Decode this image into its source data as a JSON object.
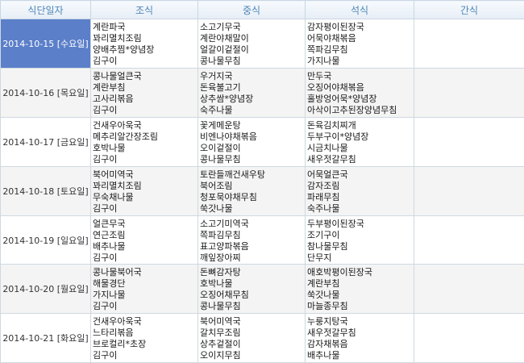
{
  "headers": {
    "date": "식단일자",
    "breakfast": "조식",
    "lunch": "중식",
    "dinner": "석식",
    "snack": "간식"
  },
  "rows": [
    {
      "date": "2014-10-15 [수요일]",
      "selected": true,
      "breakfast": [
        "계란파국",
        "꽈리멸치조림",
        "양배추찜*양념장",
        "김구이"
      ],
      "lunch": [
        "소고기무국",
        "계란야채말이",
        "얼갈이겉절이",
        "콩나물무침"
      ],
      "dinner": [
        "감자평이된장국",
        "어묵야채볶음",
        "쪽파김무침",
        "가지나물"
      ],
      "snack": []
    },
    {
      "date": "2014-10-16 [목요일]",
      "selected": false,
      "breakfast": [
        "콩나물얼큰국",
        "계란부침",
        "고사리볶음",
        "김구이"
      ],
      "lunch": [
        "우거지국",
        "돈육불고기",
        "상추쌈*양념장",
        "숙주나물"
      ],
      "dinner": [
        "만두국",
        "오징어야채볶음",
        "홀방엉어묵*양념장",
        "아삭이고추된장양념무침"
      ],
      "snack": []
    },
    {
      "date": "2014-10-17 [금요일]",
      "selected": false,
      "breakfast": [
        "건새우아욱국",
        "메추리알간장조림",
        "호박나물",
        "김구이"
      ],
      "lunch": [
        "꽃게메운탕",
        "비엔나야채볶음",
        "오이겉절이",
        "콩나물무침"
      ],
      "dinner": [
        "돈육김치찌개",
        "두부구이*양념장",
        "시금치나물",
        "새우젓갈무침"
      ],
      "snack": []
    },
    {
      "date": "2014-10-18 [토요일]",
      "selected": false,
      "breakfast": [
        "북어미역국",
        "꽈리멸치조림",
        "무숙채나물",
        "김구이"
      ],
      "lunch": [
        "토란들깨건새우탕",
        "북어조림",
        "청포묵야채무침",
        "쑥갓나물"
      ],
      "dinner": [
        "어묵얼큰국",
        "감자조림",
        "파래무침",
        "숙주나물"
      ],
      "snack": []
    },
    {
      "date": "2014-10-19 [일요일]",
      "selected": false,
      "breakfast": [
        "얼큰무국",
        "연근조림",
        "배추나물",
        "김구이"
      ],
      "lunch": [
        "소고기미역국",
        "쪽파김무침",
        "표고양파볶음",
        "깨잎장아찌"
      ],
      "dinner": [
        "두부평이된장국",
        "조기구이",
        "참나물무침",
        "단무지"
      ],
      "snack": []
    },
    {
      "date": "2014-10-20 [월요일]",
      "selected": false,
      "breakfast": [
        "콩나물북어국",
        "해물경단",
        "가지나물",
        "김구이"
      ],
      "lunch": [
        "돈뼈감자탕",
        "호박나물",
        "오징어채무침",
        "콩나물무침"
      ],
      "dinner": [
        "애호박평이된장국",
        "계란부침",
        "쑥갓나물",
        "마늘종무침"
      ],
      "snack": []
    },
    {
      "date": "2014-10-21 [화요일]",
      "selected": false,
      "breakfast": [
        "건새우아욱국",
        "느타리볶음",
        "브로컬리*초장",
        "김구이"
      ],
      "lunch": [
        "북어미역국",
        "갈치무조림",
        "상추겉절이",
        "오이지무침"
      ],
      "dinner": [
        "누룽지탕국",
        "새우젓갈무침",
        "감자채볶음",
        "배추나물"
      ],
      "snack": []
    }
  ]
}
